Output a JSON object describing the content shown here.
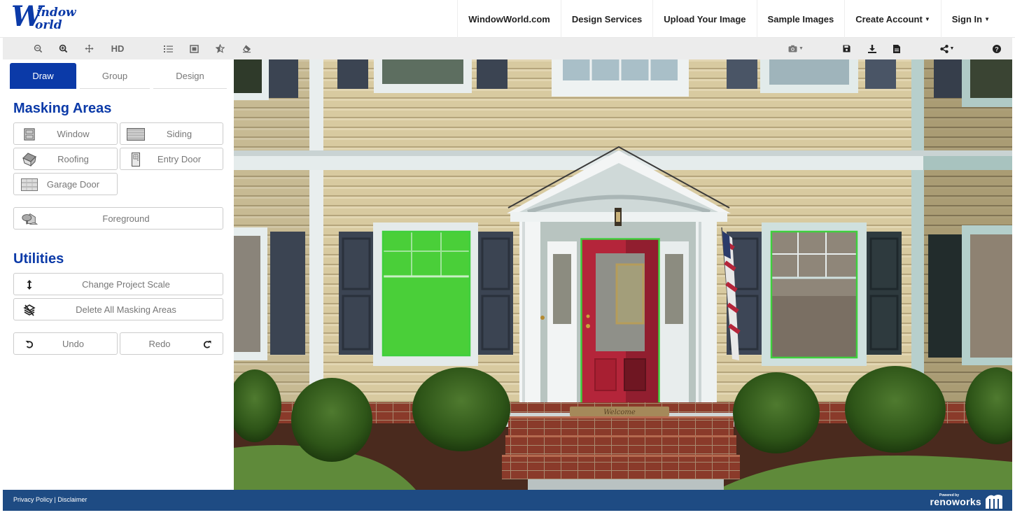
{
  "header": {
    "logo": {
      "big_letter": "W",
      "line1": "indow",
      "line2": "orld"
    },
    "nav": [
      {
        "label": "WindowWorld.com",
        "dropdown": false
      },
      {
        "label": "Design Services",
        "dropdown": false
      },
      {
        "label": "Upload Your Image",
        "dropdown": false
      },
      {
        "label": "Sample Images",
        "dropdown": false
      },
      {
        "label": "Create Account",
        "dropdown": true
      },
      {
        "label": "Sign In",
        "dropdown": true
      }
    ],
    "caret": "▼"
  },
  "toolbar": {
    "left": [
      {
        "icon": "zoom-out-icon"
      },
      {
        "icon": "zoom-in-icon",
        "active": true
      },
      {
        "icon": "move-icon"
      },
      {
        "label": "HD"
      },
      {
        "icon": "list-icon"
      },
      {
        "icon": "fit-screen-icon"
      },
      {
        "icon": "star-half-icon"
      },
      {
        "icon": "eraser-icon"
      }
    ],
    "right": [
      {
        "icon": "camera-icon",
        "dropdown": true
      },
      {
        "icon": "save-icon"
      },
      {
        "icon": "download-icon"
      },
      {
        "icon": "document-icon"
      },
      {
        "icon": "share-icon",
        "dropdown": true
      },
      {
        "icon": "help-icon"
      }
    ],
    "hd_label": "HD"
  },
  "sidebar": {
    "tabs": [
      {
        "label": "Draw",
        "active": true
      },
      {
        "label": "Group",
        "active": false
      },
      {
        "label": "Design",
        "active": false
      }
    ],
    "masking_title": "Masking Areas",
    "masking": {
      "window": "Window",
      "siding": "Siding",
      "roofing": "Roofing",
      "entry_door": "Entry Door",
      "garage_door": "Garage Door",
      "foreground": "Foreground"
    },
    "utilities_title": "Utilities",
    "utilities": {
      "change_scale": "Change Project Scale",
      "delete_all": "Delete All Masking Areas",
      "undo": "Undo",
      "redo": "Redo"
    }
  },
  "canvas": {
    "description": "House facade photo with masking areas",
    "masks": [
      {
        "type": "Window",
        "state": "selected-filled",
        "color": "#3ddc3a"
      },
      {
        "type": "Window",
        "state": "outlined",
        "color": "#3ddc3a"
      },
      {
        "type": "Entry Door",
        "state": "outlined",
        "color": "#3ddc3a"
      }
    ],
    "door_color": "#c8283a",
    "siding_color": "#d9cba2",
    "shutter_color": "#3a4250",
    "doormat_text": "Welcome"
  },
  "footer": {
    "links": "Privacy Policy | Disclaimer",
    "powered_by": "Powered by",
    "brand": "renoworks"
  },
  "colors": {
    "brand_blue": "#0b3aa8",
    "footer_blue": "#1e4b83",
    "toolbar_bg": "#ececec"
  }
}
